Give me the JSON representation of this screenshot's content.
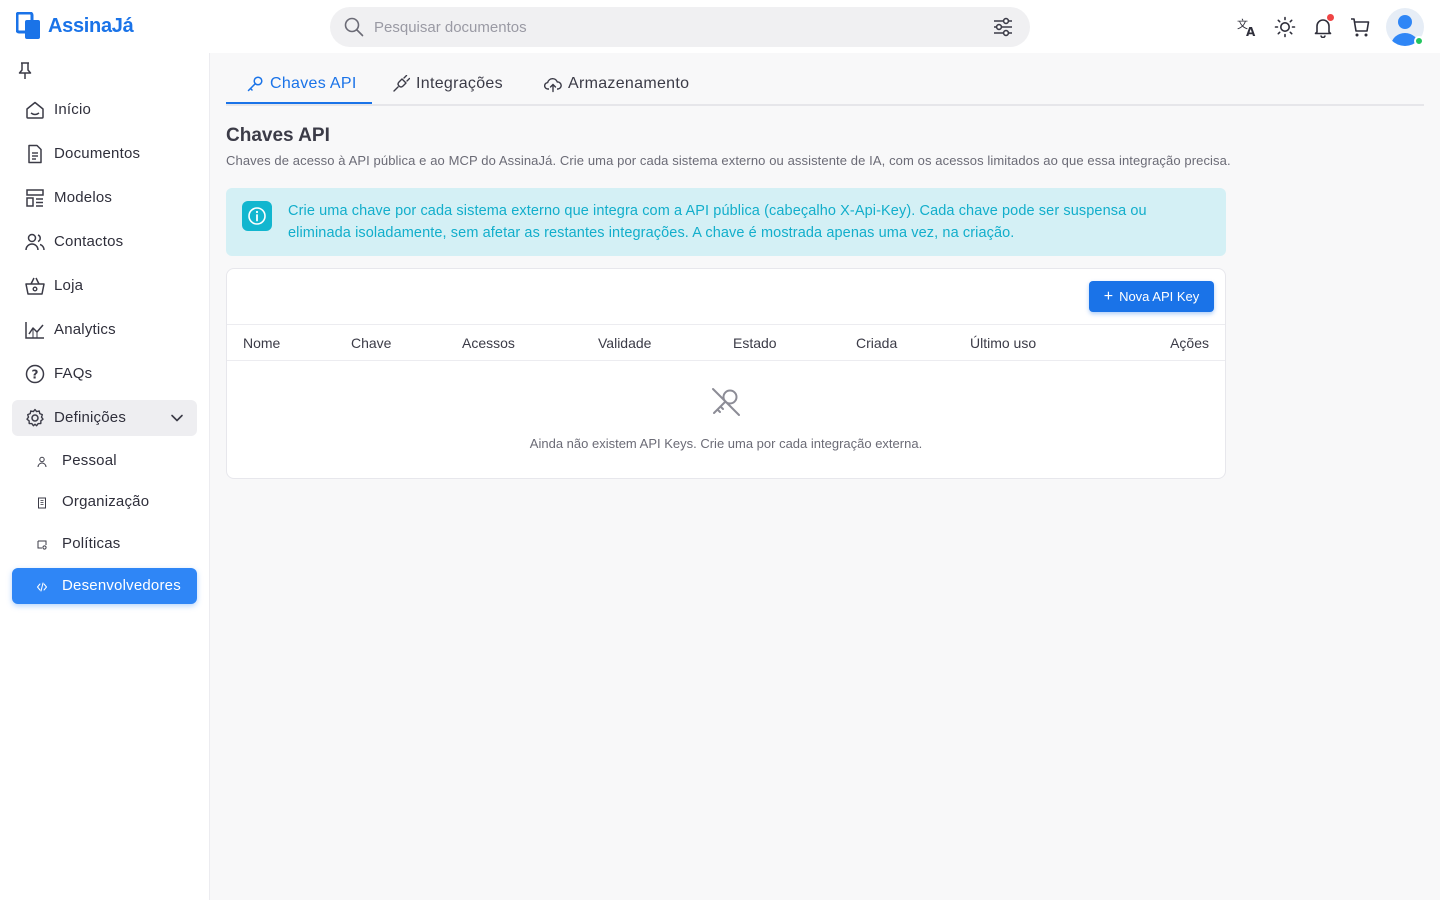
{
  "app": {
    "logo_text": "AssinaJá",
    "brand_color": "#1a73e8"
  },
  "header": {
    "search_placeholder": "Pesquisar documentos",
    "icons": [
      "translate-icon",
      "theme-sun-icon",
      "bell-icon",
      "cart-icon"
    ],
    "user_status": "online"
  },
  "sidebar": {
    "items": [
      {
        "label": "Início",
        "icon": "home-icon"
      },
      {
        "label": "Documentos",
        "icon": "document-icon"
      },
      {
        "label": "Modelos",
        "icon": "template-icon"
      },
      {
        "label": "Contactos",
        "icon": "contacts-icon"
      },
      {
        "label": "Loja",
        "icon": "store-icon"
      },
      {
        "label": "Analytics",
        "icon": "analytics-icon"
      },
      {
        "label": "FAQs",
        "icon": "help-icon"
      },
      {
        "label": "Definições",
        "icon": "gear-icon",
        "expanded": true
      }
    ],
    "sub_items": [
      {
        "label": "Pessoal",
        "icon": "person-icon"
      },
      {
        "label": "Organização",
        "icon": "building-icon"
      },
      {
        "label": "Políticas",
        "icon": "policy-icon"
      },
      {
        "label": "Desenvolvedores",
        "icon": "code-icon",
        "active": true
      }
    ]
  },
  "tabs": [
    {
      "label": "Chaves API",
      "icon": "key-icon",
      "active": true
    },
    {
      "label": "Integrações",
      "icon": "plug-icon"
    },
    {
      "label": "Armazenamento",
      "icon": "cloud-upload-icon"
    }
  ],
  "main": {
    "title": "Chaves API",
    "description": "Chaves de acesso à API pública e ao MCP do AssinaJá. Crie uma por cada sistema externo ou assistente de IA, com os acessos limitados ao que essa integração precisa.",
    "info": "Crie uma chave por cada sistema externo que integra com a API pública (cabeçalho X-Api-Key). Cada chave pode ser suspensa ou eliminada isoladamente, sem afetar as restantes integrações. A chave é mostrada apenas uma vez, na criação.",
    "new_button": "Nova API Key",
    "table": {
      "columns": [
        "Nome",
        "Chave",
        "Acessos",
        "Validade",
        "Estado",
        "Criada",
        "Último uso",
        "Ações"
      ],
      "rows": [],
      "empty_text": "Ainda não existem API Keys. Crie uma por cada integração externa."
    }
  }
}
